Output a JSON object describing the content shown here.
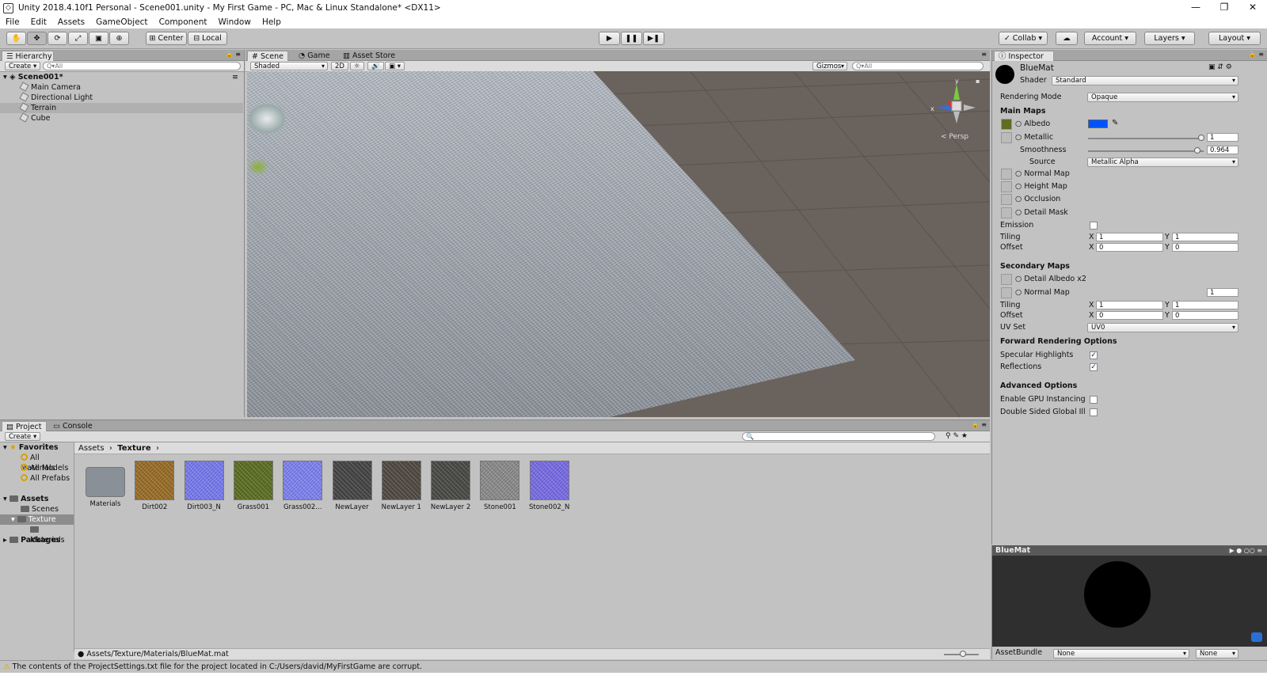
{
  "window": {
    "title": "Unity 2018.4.10f1 Personal - Scene001.unity - My First Game - PC, Mac & Linux Standalone* <DX11>",
    "minimize": "—",
    "restore": "❐",
    "close": "✕"
  },
  "menu": [
    "File",
    "Edit",
    "Assets",
    "GameObject",
    "Component",
    "Window",
    "Help"
  ],
  "toolbar": {
    "center": "Center",
    "local": "Local",
    "collab": "Collab",
    "account": "Account",
    "layers": "Layers",
    "layout": "Layout"
  },
  "hierarchy": {
    "tab": "Hierarchy",
    "create": "Create",
    "search_placeholder": "Q▾All",
    "scene": "Scene001*",
    "items": [
      "Main Camera",
      "Directional Light",
      "Terrain",
      "Cube"
    ]
  },
  "scene": {
    "tabs": [
      "Scene",
      "Game",
      "Asset Store"
    ],
    "shaded": "Shaded",
    "twoD": "2D",
    "gizmos": "Gizmos",
    "search_placeholder": "Q▾All",
    "persp": "< Persp",
    "axis_y": "y",
    "axis_x": "x"
  },
  "inspector": {
    "tab": "Inspector",
    "name": "BlueMat",
    "shader_label": "Shader",
    "shader": "Standard",
    "rendering_mode_label": "Rendering Mode",
    "rendering_mode": "Opaque",
    "main_maps": "Main Maps",
    "albedo": "Albedo",
    "metallic": "Metallic",
    "metallic_value": "1",
    "smoothness": "Smoothness",
    "smoothness_value": "0.964",
    "source_label": "Source",
    "source": "Metallic Alpha",
    "normal_map": "Normal Map",
    "height_map": "Height Map",
    "occlusion": "Occlusion",
    "detail_mask": "Detail Mask",
    "emission": "Emission",
    "tiling": "Tiling",
    "offset": "Offset",
    "x": "X",
    "y": "Y",
    "tiling_x": "1",
    "tiling_y": "1",
    "offset_x": "0",
    "offset_y": "0",
    "secondary_maps": "Secondary Maps",
    "detail_albedo": "Detail Albedo x2",
    "normal_map2": "Normal Map",
    "normal_map2_value": "1",
    "tiling2_x": "1",
    "tiling2_y": "1",
    "offset2_x": "0",
    "offset2_y": "0",
    "uv_set_label": "UV Set",
    "uv_set": "UV0",
    "forward_options": "Forward Rendering Options",
    "specular": "Specular Highlights",
    "reflections": "Reflections",
    "advanced": "Advanced Options",
    "gpu_instancing": "Enable GPU Instancing",
    "double_sided": "Double Sided Global Ill",
    "preview_title": "BlueMat",
    "assetbundle_label": "AssetBundle",
    "assetbundle": "None",
    "assetbundle_variant": "None",
    "colors": {
      "albedo": "#0052ff",
      "accent_check": "#1a3a8a"
    }
  },
  "project": {
    "tabs": [
      "Project",
      "Console"
    ],
    "create": "Create",
    "favorites": "Favorites",
    "fav_items": [
      "All Materials",
      "All Models",
      "All Prefabs"
    ],
    "assets": "Assets",
    "asset_tree": [
      "Scenes",
      "Texture",
      "Materials"
    ],
    "packages": "Packages",
    "breadcrumb": [
      "Assets",
      "Texture"
    ],
    "files": [
      {
        "name": "Materials",
        "color": "#8a9098"
      },
      {
        "name": "Dirt002",
        "color": "#9b6f2a"
      },
      {
        "name": "Dirt003_N",
        "color": "#7a7cf0"
      },
      {
        "name": "Grass001",
        "color": "#5e7023"
      },
      {
        "name": "Grass002...",
        "color": "#8084f2"
      },
      {
        "name": "NewLayer",
        "color": "#474747"
      },
      {
        "name": "NewLayer 1",
        "color": "#524b44"
      },
      {
        "name": "NewLayer 2",
        "color": "#4b4c48"
      },
      {
        "name": "Stone001",
        "color": "#8d8d8d"
      },
      {
        "name": "Stone002_N",
        "color": "#7a6ee8"
      }
    ],
    "path": "Assets/Texture/Materials/BlueMat.mat"
  },
  "status": "The contents of the ProjectSettings.txt file for the project located in C:/Users/david/MyFirstGame are corrupt."
}
